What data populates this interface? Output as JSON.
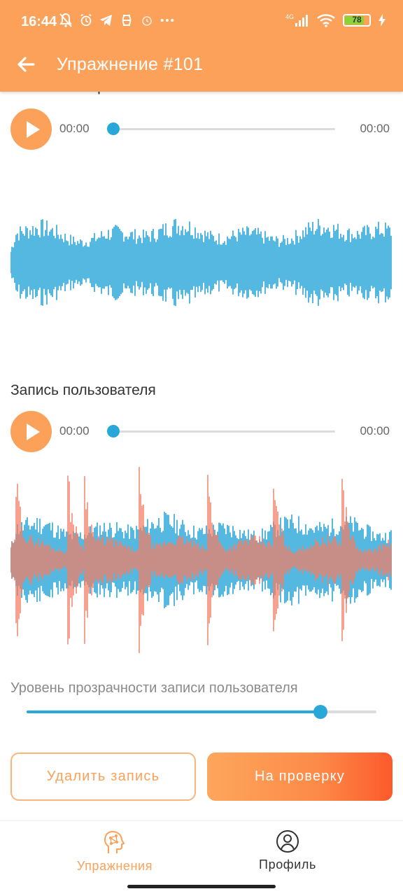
{
  "status_bar": {
    "time": "16:44",
    "network": "4G",
    "battery": "78"
  },
  "app_bar": {
    "title": "Упражнение #101"
  },
  "reference": {
    "title": "Эталонное произношение",
    "current_time": "00:00",
    "total_time": "00:00",
    "progress": 0
  },
  "user_recording": {
    "title": "Запись пользователя",
    "current_time": "00:00",
    "total_time": "00:00",
    "progress": 0
  },
  "opacity": {
    "label": "Уровень прозрачности записи пользователя",
    "value": 0.84
  },
  "actions": {
    "delete_label": "Удалить запись",
    "submit_label": "На проверку"
  },
  "bottom_nav": {
    "exercises_label": "Упражнения",
    "profile_label": "Профиль"
  },
  "colors": {
    "accent": "#fba159",
    "wave_reference": "#2aa7d9",
    "wave_user": "#f4755a",
    "battery": "#8bd437"
  }
}
